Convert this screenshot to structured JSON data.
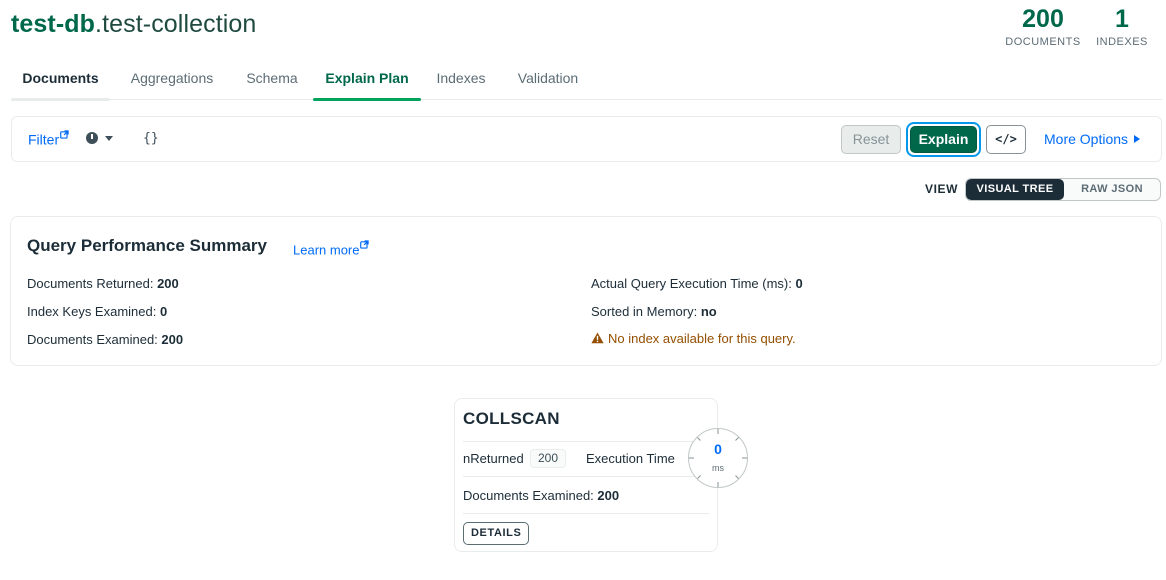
{
  "header": {
    "db_name": "test-db",
    "collection_name": ".test-collection",
    "stats": [
      {
        "value": "200",
        "label": "DOCUMENTS"
      },
      {
        "value": "1",
        "label": "INDEXES"
      }
    ]
  },
  "tabs": [
    {
      "label": "Documents"
    },
    {
      "label": "Aggregations"
    },
    {
      "label": "Schema"
    },
    {
      "label": "Explain Plan"
    },
    {
      "label": "Indexes"
    },
    {
      "label": "Validation"
    }
  ],
  "query_bar": {
    "filter_label": "Filter",
    "filter_value": "{}",
    "reset_label": "Reset",
    "explain_label": "Explain",
    "code_label": "</>",
    "more_options_label": "More Options"
  },
  "view_toggle": {
    "label": "VIEW",
    "options": [
      "VISUAL TREE",
      "RAW JSON"
    ],
    "selected": "VISUAL TREE"
  },
  "summary": {
    "title": "Query Performance Summary",
    "learn_more": "Learn more",
    "left": [
      {
        "label": "Documents Returned: ",
        "value": "200"
      },
      {
        "label": "Index Keys Examined: ",
        "value": "0"
      },
      {
        "label": "Documents Examined: ",
        "value": "200"
      }
    ],
    "right": [
      {
        "label": "Actual Query Execution Time (ms): ",
        "value": "0"
      },
      {
        "label": "Sorted in Memory: ",
        "value": "no"
      }
    ],
    "warning": "No index available for this query."
  },
  "stage": {
    "name": "COLLSCAN",
    "nreturned_label": "nReturned",
    "nreturned_value": "200",
    "exec_label": "Execution Time",
    "exec_value": "0",
    "exec_unit": "ms",
    "docs_label": "Documents Examined: ",
    "docs_value": "200",
    "details_label": "DETAILS"
  },
  "colors": {
    "brand_green": "#00684a",
    "link_blue": "#016bf8",
    "warning": "#944f01",
    "dark": "#1c2d38"
  }
}
